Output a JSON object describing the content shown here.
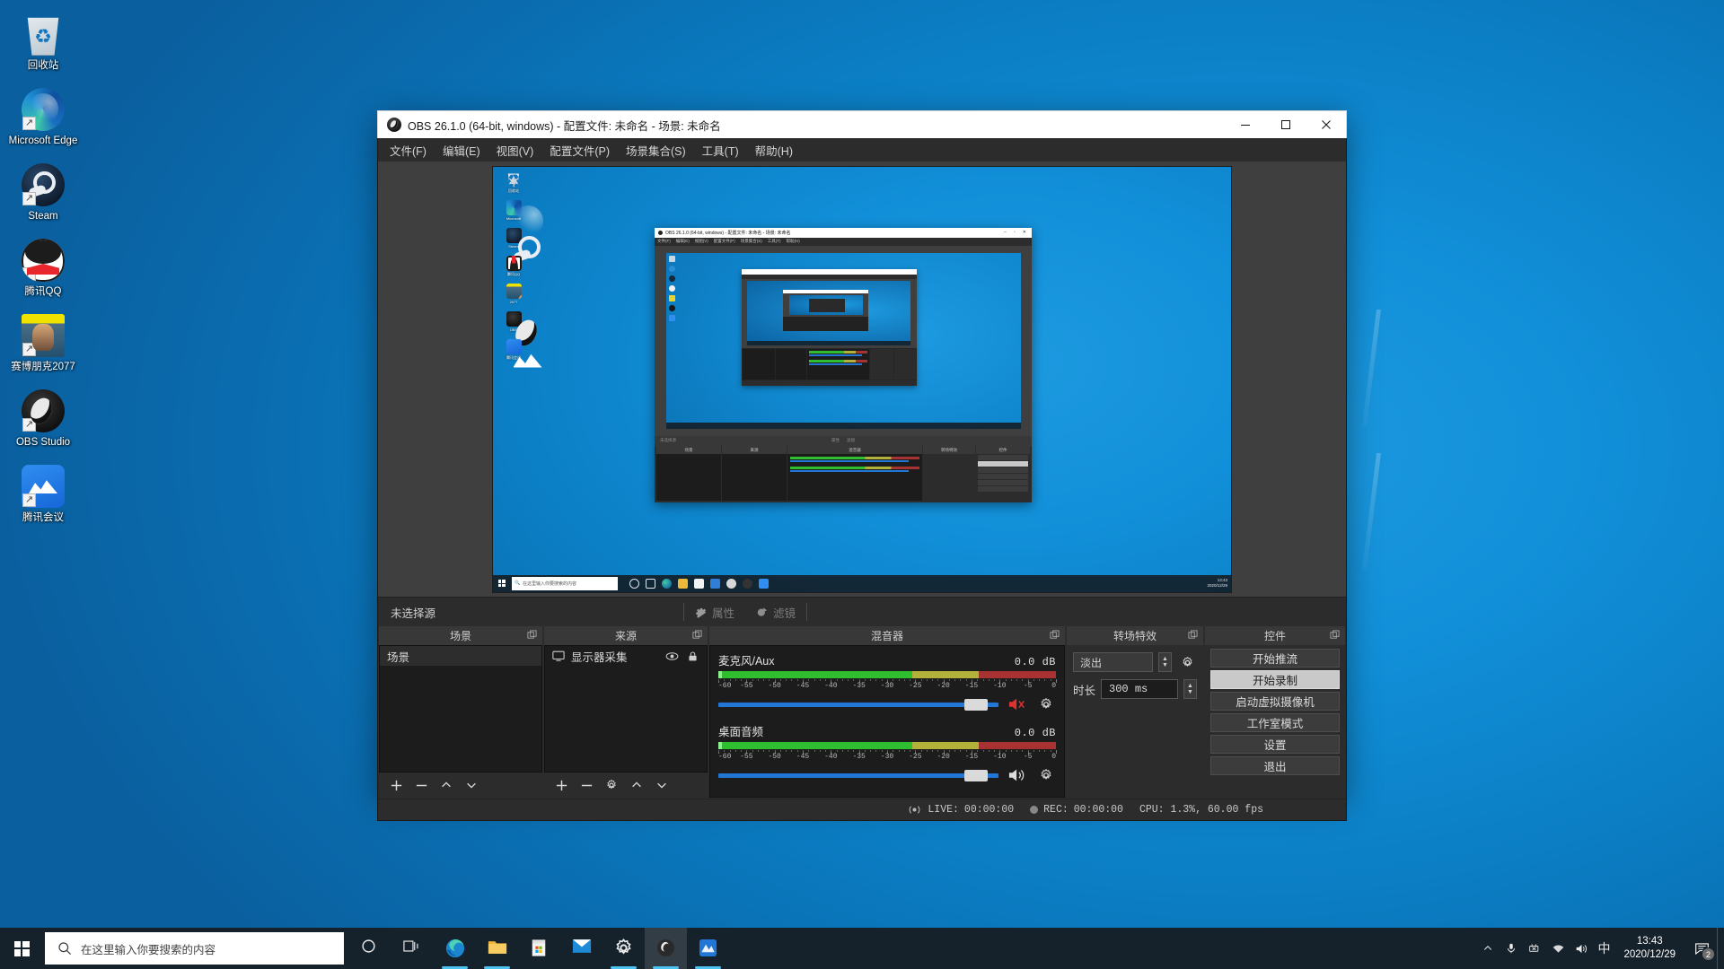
{
  "desktop": {
    "icons": [
      {
        "label": "回收站",
        "icon": "recycle-bin-icon",
        "art": "ic-recycle",
        "shortcut": false
      },
      {
        "label": "Microsoft Edge",
        "icon": "microsoft-edge-icon",
        "art": "ic-edge",
        "shortcut": true
      },
      {
        "label": "Steam",
        "icon": "steam-icon",
        "art": "ic-steam",
        "shortcut": true
      },
      {
        "label": "腾讯QQ",
        "icon": "tencent-qq-icon",
        "art": "ic-qq",
        "shortcut": true
      },
      {
        "label": "赛博朋克2077",
        "icon": "cyberpunk-2077-icon",
        "art": "ic-cp",
        "shortcut": true
      },
      {
        "label": "OBS Studio",
        "icon": "obs-studio-icon",
        "art": "ic-obs",
        "shortcut": true
      },
      {
        "label": "腾讯会议",
        "icon": "tencent-meeting-icon",
        "art": "ic-meet",
        "shortcut": true
      }
    ]
  },
  "obs": {
    "title": "OBS 26.1.0 (64-bit, windows) - 配置文件: 未命名 - 场景: 未命名",
    "window_buttons": {
      "minimize": "—",
      "maximize": "▢",
      "close": "✕"
    },
    "menu": [
      {
        "label": "文件(F)"
      },
      {
        "label": "编辑(E)"
      },
      {
        "label": "视图(V)"
      },
      {
        "label": "配置文件(P)"
      },
      {
        "label": "场景集合(S)"
      },
      {
        "label": "工具(T)"
      },
      {
        "label": "帮助(H)"
      }
    ],
    "selection_bar": {
      "status": "未选择源",
      "properties_label": "属性",
      "filters_label": "滤镜"
    },
    "scenes": {
      "title": "场景",
      "items": [
        {
          "label": "场景",
          "selected": true
        }
      ],
      "toolbar": [
        "+",
        "−",
        "∧",
        "∨"
      ]
    },
    "sources": {
      "title": "来源",
      "items": [
        {
          "label": "显示器采集",
          "visible": true,
          "locked": true
        }
      ],
      "toolbar": [
        "+",
        "−",
        "⚙",
        "∧",
        "∨"
      ]
    },
    "mixer": {
      "title": "混音器",
      "scale_ticks": [
        "-60",
        "-55",
        "-50",
        "-45",
        "-40",
        "-35",
        "-30",
        "-25",
        "-20",
        "-15",
        "-10",
        "-5",
        "0"
      ],
      "channels": [
        {
          "name": "麦克风/Aux",
          "db": "0.0 dB",
          "volume_pct": 96,
          "muted": true,
          "icon": "mute-speaker-icon"
        },
        {
          "name": "桌面音频",
          "db": "0.0 dB",
          "volume_pct": 96,
          "muted": false,
          "icon": "speaker-icon"
        }
      ]
    },
    "transitions": {
      "title": "转场特效",
      "selected": "淡出",
      "duration_label": "时长",
      "duration_value": "300 ms"
    },
    "controls": {
      "title": "控件",
      "buttons": [
        {
          "label": "开始推流",
          "highlighted": false
        },
        {
          "label": "开始录制",
          "highlighted": true
        },
        {
          "label": "启动虚拟摄像机",
          "highlighted": false
        },
        {
          "label": "工作室模式",
          "highlighted": false
        },
        {
          "label": "设置",
          "highlighted": false
        },
        {
          "label": "退出",
          "highlighted": false
        }
      ]
    },
    "status": {
      "live_label": "LIVE:",
      "live_time": "00:00:00",
      "rec_label": "REC:",
      "rec_time": "00:00:00",
      "cpu": "CPU: 1.3%, 60.00 fps"
    }
  },
  "nested_preview": {
    "title": "OBS 26.1.0 (64-bit, windows) - 配置文件: 未命名 - 场景: 未命名",
    "menu": [
      "文件(F)",
      "编辑(E)",
      "视图(V)",
      "配置文件(P)",
      "场景集合(S)",
      "工具(T)",
      "帮助(H)"
    ],
    "selection_status": "未选择源",
    "properties_label": "属性",
    "filters_label": "滤镜",
    "docks": [
      "场景",
      "来源",
      "混音器",
      "转场特效",
      "控件"
    ],
    "taskbar_placeholder": "在这里输入你要搜索的内容",
    "clock": "13:43",
    "date": "2020/12/29"
  },
  "taskbar": {
    "search_placeholder": "在这里输入你要搜索的内容",
    "pinned": [
      {
        "name": "cortana-icon",
        "art": "tb-cortana",
        "running": false,
        "active": false
      },
      {
        "name": "task-view-icon",
        "art": "tb-taskview",
        "running": false,
        "active": false
      },
      {
        "name": "microsoft-edge-icon",
        "art": "tb-edge",
        "running": true,
        "active": false
      },
      {
        "name": "file-explorer-icon",
        "art": "tb-folder",
        "running": true,
        "active": false
      },
      {
        "name": "microsoft-store-icon",
        "art": "tb-store",
        "running": false,
        "active": false
      },
      {
        "name": "mail-icon",
        "art": "tb-mail",
        "running": false,
        "active": false
      },
      {
        "name": "settings-icon",
        "art": "tb-settings",
        "running": true,
        "active": false
      },
      {
        "name": "obs-studio-icon",
        "art": "tb-obs",
        "running": true,
        "active": true
      },
      {
        "name": "tencent-meeting-icon",
        "art": "tb-meet",
        "running": true,
        "active": false
      }
    ],
    "tray": [
      {
        "name": "show-hidden-icons-chevron",
        "glyph": "⌃"
      },
      {
        "name": "microphone-icon",
        "glyph": "🎤"
      },
      {
        "name": "network-disconnected-icon",
        "glyph": "⚟"
      },
      {
        "name": "wifi-icon",
        "glyph": "📶"
      },
      {
        "name": "volume-icon",
        "glyph": "🔊"
      },
      {
        "name": "ime-chinese-icon",
        "glyph": "中"
      }
    ],
    "clock_time": "13:43",
    "clock_date": "2020/12/29",
    "notification_count": "2"
  },
  "colors": {
    "obs_panel": "#2c2c2c",
    "obs_dark": "#1c1c1c",
    "accent_blue": "#2176d6",
    "meter_green": "#2fbe2f",
    "meter_yellow": "#b2b23a",
    "meter_red": "#a83232",
    "taskbar": "#15212b",
    "highlight_button": "#c9c9c9"
  }
}
